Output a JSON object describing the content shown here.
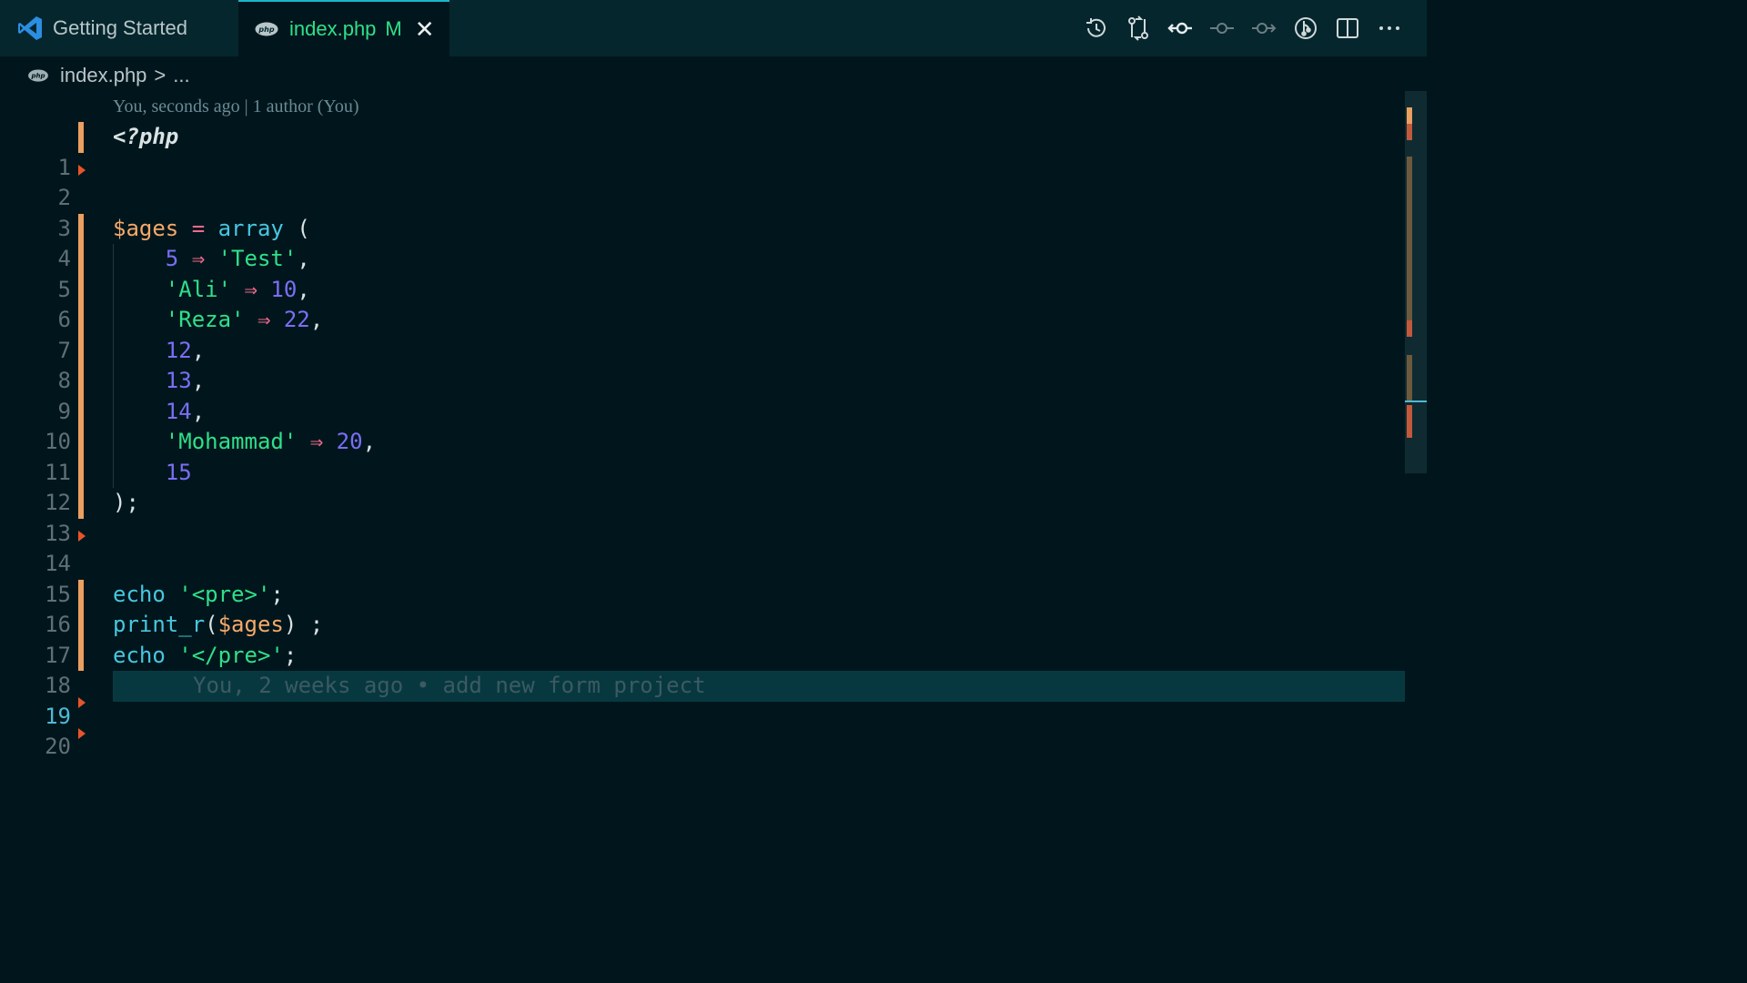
{
  "tabs": [
    {
      "label": "Getting Started"
    },
    {
      "label": "index.php",
      "status": "M"
    }
  ],
  "breadcrumb": {
    "file": "index.php",
    "sep": ">",
    "more": "..."
  },
  "codelens": "You, seconds ago | 1 author (You)",
  "current_line_blame": "You, 2 weeks ago • add new form project",
  "toolbar_icons": [
    "history-icon",
    "compare-changes-icon",
    "previous-commit-icon",
    "commit-icon",
    "next-commit-icon",
    "git-graph-icon",
    "split-editor-icon",
    "more-actions-icon"
  ],
  "code": {
    "line1": "<?php",
    "line4_var": "$ages",
    "line4_op": "=",
    "line4_fn": "array",
    "line4_paren": "(",
    "line5_key": "5",
    "line5_val": "'Test'",
    "line6_key": "'Ali'",
    "line6_val": "10",
    "line7_key": "'Reza'",
    "line7_val": "22",
    "line8": "12",
    "line9": "13",
    "line10": "14",
    "line11_key": "'Mohammad'",
    "line11_val": "20",
    "line12": "15",
    "line13": ");",
    "line16_fn": "echo",
    "line16_str": "'<pre>'",
    "line17_fn": "print_r",
    "line17_var": "$ages",
    "line18_fn": "echo",
    "line18_str": "'</pre>'",
    "arrow": "⇒",
    "comma": ",",
    "semicolon": ";"
  },
  "line_numbers": [
    "1",
    "2",
    "3",
    "4",
    "5",
    "6",
    "7",
    "8",
    "9",
    "10",
    "11",
    "12",
    "13",
    "14",
    "15",
    "16",
    "17",
    "18",
    "19",
    "20"
  ],
  "colors": {
    "accent": "#1ab6cb",
    "modified_gutter": "#e9a060",
    "deleted_gutter": "#e8542a",
    "string": "#2fe08a",
    "number": "#7b6ef6",
    "variable": "#f5a96a",
    "operator": "#f26a8d",
    "function": "#48c6e0"
  }
}
